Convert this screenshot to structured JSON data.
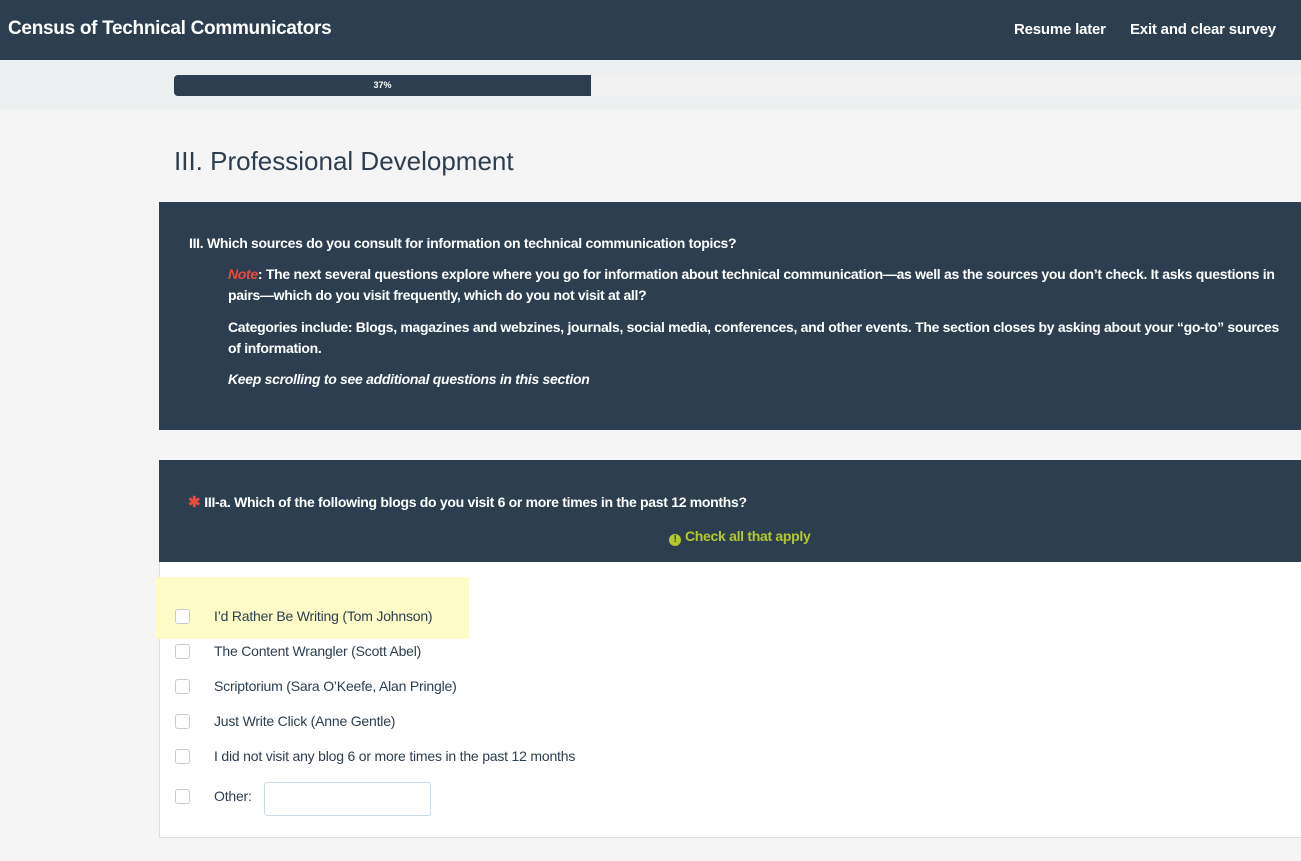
{
  "header": {
    "title": "Census of Technical Communicators",
    "resume_label": "Resume later",
    "exit_label": "Exit and clear survey"
  },
  "progress": {
    "percent": 37,
    "label": "37%"
  },
  "section": {
    "title": "III. Professional Development"
  },
  "intro": {
    "question": "III. Which sources do you consult for information on technical communication topics?",
    "note_word": "Note",
    "note_text": ": The next several questions explore where you go for information about technical communication—as well as the sources you don’t check. It asks questions in pairs—which do you visit frequently, which do you not visit at all?",
    "categories_text": "Categories include: Blogs, magazines and webzines, journals, social media, conferences, and other events. The section closes by asking about your “go-to” sources of information.",
    "scroll_text": "Keep scrolling to see additional questions in this section"
  },
  "question": {
    "required_mark": "✱",
    "text": "III-a. Which of the following blogs do you visit 6 or more times in the past 12 months?",
    "tip_icon": "!",
    "tip": "Check all that apply",
    "options": [
      {
        "label": "I’d Rather Be Writing (Tom Johnson)"
      },
      {
        "label": "The Content Wrangler (Scott Abel)"
      },
      {
        "label": "Scriptorium (Sara O’Keefe, Alan Pringle)"
      },
      {
        "label": "Just Write Click (Anne Gentle)"
      },
      {
        "label": "I did not visit any blog 6 or more times in the past 12 months"
      },
      {
        "label": "Other:"
      }
    ],
    "other_value": ""
  },
  "colors": {
    "primary": "#2c3e50",
    "required": "#e74c3c",
    "tip": "#b5c92c",
    "highlight": "#fdfcc8"
  }
}
